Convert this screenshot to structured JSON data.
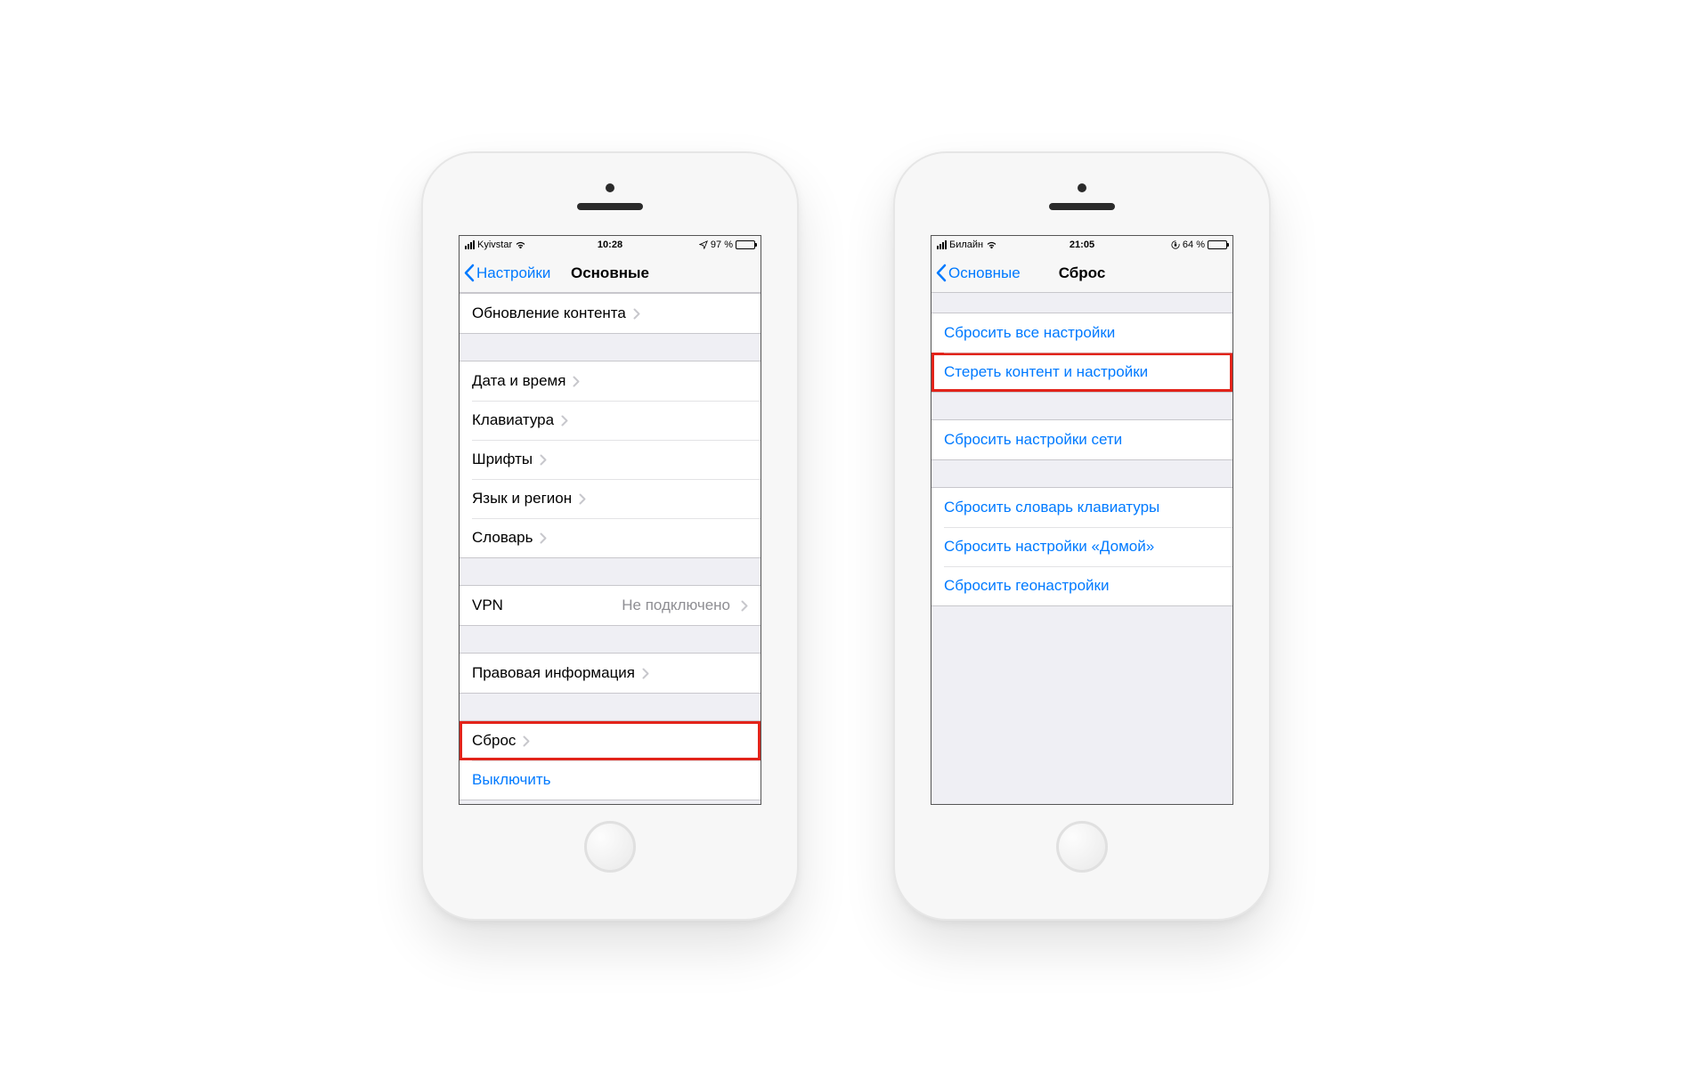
{
  "colors": {
    "ios_blue": "#007aff",
    "highlight": "#e2231a"
  },
  "phone_left": {
    "status": {
      "carrier": "Kyivstar",
      "time": "10:28",
      "battery_text": "97 %",
      "battery_pct": 97,
      "charging": true,
      "show_location": true,
      "show_lock": false
    },
    "nav": {
      "back": "Настройки",
      "title": "Основные"
    },
    "groups": [
      {
        "gap": "first",
        "cells": [
          {
            "label": "Обновление контента",
            "detail": "",
            "link": false,
            "chevron": true,
            "hl": false
          }
        ]
      },
      {
        "gap": "normal",
        "cells": [
          {
            "label": "Дата и время",
            "detail": "",
            "link": false,
            "chevron": true,
            "hl": false
          },
          {
            "label": "Клавиатура",
            "detail": "",
            "link": false,
            "chevron": true,
            "hl": false
          },
          {
            "label": "Шрифты",
            "detail": "",
            "link": false,
            "chevron": true,
            "hl": false
          },
          {
            "label": "Язык и регион",
            "detail": "",
            "link": false,
            "chevron": true,
            "hl": false
          },
          {
            "label": "Словарь",
            "detail": "",
            "link": false,
            "chevron": true,
            "hl": false
          }
        ]
      },
      {
        "gap": "normal",
        "cells": [
          {
            "label": "VPN",
            "detail": "Не подключено",
            "link": false,
            "chevron": true,
            "hl": false
          }
        ]
      },
      {
        "gap": "normal",
        "cells": [
          {
            "label": "Правовая информация",
            "detail": "",
            "link": false,
            "chevron": true,
            "hl": false
          }
        ]
      },
      {
        "gap": "normal",
        "cells": [
          {
            "label": "Сброс",
            "detail": "",
            "link": false,
            "chevron": true,
            "hl": true
          },
          {
            "label": "Выключить",
            "detail": "",
            "link": true,
            "chevron": false,
            "hl": false
          }
        ]
      }
    ]
  },
  "phone_right": {
    "status": {
      "carrier": "Билайн",
      "time": "21:05",
      "battery_text": "64 %",
      "battery_pct": 64,
      "charging": false,
      "show_location": false,
      "show_lock": true
    },
    "nav": {
      "back": "Основные",
      "title": "Сброс"
    },
    "groups": [
      {
        "gap": "small",
        "cells": [
          {
            "label": "Сбросить все настройки",
            "detail": "",
            "link": true,
            "chevron": false,
            "hl": false
          },
          {
            "label": "Стереть контент и настройки",
            "detail": "",
            "link": true,
            "chevron": false,
            "hl": true
          }
        ]
      },
      {
        "gap": "normal",
        "cells": [
          {
            "label": "Сбросить настройки сети",
            "detail": "",
            "link": true,
            "chevron": false,
            "hl": false
          }
        ]
      },
      {
        "gap": "normal",
        "cells": [
          {
            "label": "Сбросить словарь клавиатуры",
            "detail": "",
            "link": true,
            "chevron": false,
            "hl": false
          },
          {
            "label": "Сбросить настройки «Домой»",
            "detail": "",
            "link": true,
            "chevron": false,
            "hl": false
          },
          {
            "label": "Сбросить геонастройки",
            "detail": "",
            "link": true,
            "chevron": false,
            "hl": false
          }
        ]
      }
    ]
  }
}
